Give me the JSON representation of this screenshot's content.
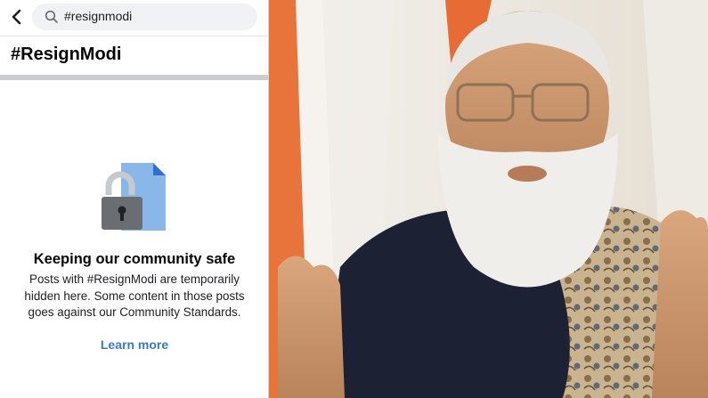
{
  "search": {
    "value": "#resignmodi"
  },
  "page": {
    "title": "#ResignModi"
  },
  "notice": {
    "heading": "Keeping our community safe",
    "body": "Posts with #ResignModi are temporarily hidden here. Some content in those posts goes against our Community Standards.",
    "learn_more": "Learn more"
  },
  "icons": {
    "back": "back-arrow-icon",
    "search": "search-icon",
    "illustration": "locked-document-icon"
  },
  "colors": {
    "link": "#3b79c3",
    "search_bg": "#f0f2f5",
    "lock_body": "#6a6d71",
    "document": "#8ab7ea"
  }
}
